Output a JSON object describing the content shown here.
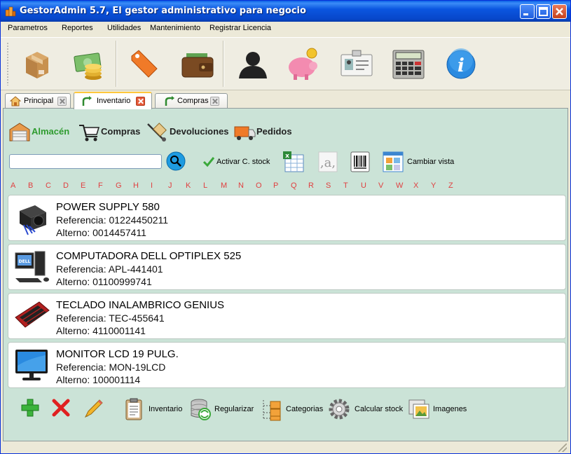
{
  "window": {
    "title": "GestorAdmin 5.7,  El gestor administrativo para negocio"
  },
  "menu": [
    "Parametros",
    "Reportes",
    "Utilidades",
    "Mantenimiento",
    "Registrar Licencia"
  ],
  "toolbar": {
    "buttons": [
      "box-icon",
      "money-icon",
      "tag-icon",
      "wallet-icon",
      "user-icon",
      "piggy-bank-icon",
      "id-card-icon",
      "calculator-icon",
      "info-icon"
    ]
  },
  "tabs": [
    {
      "label": "Principal",
      "icon": "home-icon",
      "active": false
    },
    {
      "label": "Inventario",
      "icon": "arrow-icon",
      "active": true
    },
    {
      "label": "Compras",
      "icon": "arrow-icon",
      "active": false
    }
  ],
  "categories": [
    {
      "label": "Almacén",
      "icon": "warehouse-icon",
      "active": true
    },
    {
      "label": "Compras",
      "icon": "cart-icon",
      "active": false
    },
    {
      "label": "Devoluciones",
      "icon": "hand-truck-icon",
      "active": false
    },
    {
      "label": "Pedidos",
      "icon": "truck-icon",
      "active": false
    }
  ],
  "search": {
    "value": "",
    "placeholder": ""
  },
  "actions": {
    "activar_stock": "Activar C. stock",
    "cambiar_vista": "Cambiar vista"
  },
  "alphabet": [
    "A",
    "B",
    "C",
    "D",
    "E",
    "F",
    "G",
    "H",
    "I",
    "J",
    "K",
    "L",
    "M",
    "N",
    "O",
    "P",
    "Q",
    "R",
    "S",
    "T",
    "U",
    "V",
    "W",
    "X",
    "Y",
    "Z"
  ],
  "products": [
    {
      "name": "POWER SUPPLY 580",
      "referencia": "Referencia: 01224450211",
      "alterno": "Alterno: 0014457411",
      "icon": "power-supply-icon"
    },
    {
      "name": "COMPUTADORA DELL OPTIPLEX 525",
      "referencia": "Referencia: APL-441401",
      "alterno": "Alterno: 01100999741",
      "icon": "computer-icon"
    },
    {
      "name": "TECLADO INALAMBRICO GENIUS",
      "referencia": "Referencia: TEC-455641",
      "alterno": "Alterno: 4110001141",
      "icon": "keyboard-icon"
    },
    {
      "name": "MONITOR LCD 19 PULG.",
      "referencia": "Referencia: MON-19LCD",
      "alterno": "Alterno: 100001114",
      "icon": "monitor-icon"
    }
  ],
  "bottom": {
    "inventario": "Inventario",
    "regularizar": "Regularizar",
    "categorias": "Categorias",
    "calcular_stock": "Calcular stock",
    "imagenes": "Imagenes"
  },
  "colors": {
    "titlebar": "#0b56e0",
    "panel": "#cbe3d7",
    "active_category": "#2f9b2f",
    "alphabet": "#e04040"
  }
}
